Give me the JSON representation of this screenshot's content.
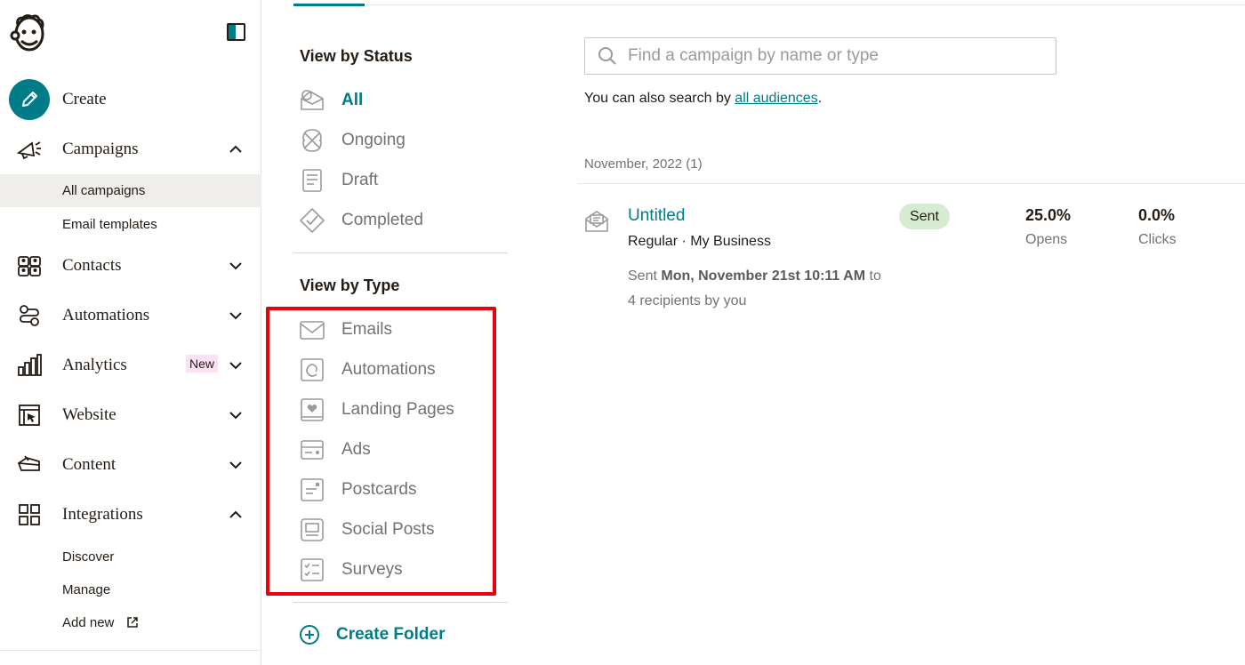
{
  "sidebar": {
    "create_label": "Create",
    "items": [
      {
        "label": "Campaigns",
        "icon": "megaphone-icon"
      },
      {
        "label": "Contacts",
        "icon": "contacts-icon"
      },
      {
        "label": "Automations",
        "icon": "automations-icon"
      },
      {
        "label": "Analytics",
        "icon": "analytics-icon",
        "badge": "New"
      },
      {
        "label": "Website",
        "icon": "website-icon"
      },
      {
        "label": "Content",
        "icon": "content-icon"
      },
      {
        "label": "Integrations",
        "icon": "integrations-icon"
      }
    ],
    "campaigns_sub": [
      "All campaigns",
      "Email templates"
    ],
    "integrations_sub": [
      "Discover",
      "Manage",
      "Add new"
    ]
  },
  "filters": {
    "status_title": "View by Status",
    "status_items": [
      "All",
      "Ongoing",
      "Draft",
      "Completed"
    ],
    "type_title": "View by Type",
    "type_items": [
      "Emails",
      "Automations",
      "Landing Pages",
      "Ads",
      "Postcards",
      "Social Posts",
      "Surveys"
    ],
    "create_folder": "Create Folder"
  },
  "search": {
    "placeholder": "Find a campaign by name or type",
    "hint_prefix": "You can also search by ",
    "hint_link": "all audiences",
    "hint_suffix": "."
  },
  "campaign_list": {
    "group_label": "November, 2022 (1)",
    "campaign": {
      "title": "Untitled",
      "subtitle": "Regular · My Business",
      "sent_prefix": "Sent ",
      "sent_date": "Mon, November 21st 10:11 AM",
      "sent_suffix": " to",
      "sent_line2": "4 recipients by you",
      "status": "Sent",
      "opens_value": "25.0%",
      "opens_label": "Opens",
      "clicks_value": "0.0%",
      "clicks_label": "Clicks"
    }
  },
  "colors": {
    "accent": "#007c89",
    "highlight": "#e8000b",
    "sent_badge": "#d6ebd1",
    "new_badge": "#fbe1f4"
  }
}
